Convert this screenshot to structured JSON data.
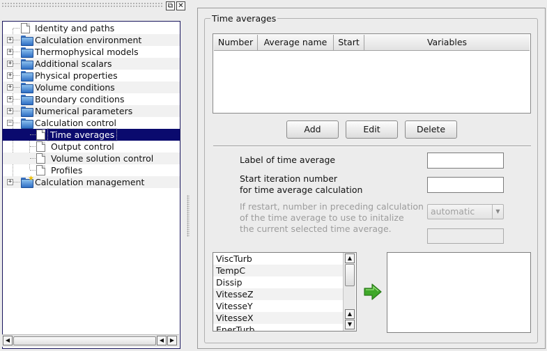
{
  "tree": {
    "items": [
      {
        "label": "Identity and paths",
        "level": 0,
        "icon": "page-icon",
        "expandable": false,
        "selected": false
      },
      {
        "label": "Calculation environment",
        "level": 0,
        "icon": "folder-icon",
        "expandable": true,
        "selected": false
      },
      {
        "label": "Thermophysical models",
        "level": 0,
        "icon": "folder-icon",
        "expandable": true,
        "selected": false
      },
      {
        "label": "Additional scalars",
        "level": 0,
        "icon": "folder-icon",
        "expandable": true,
        "selected": false
      },
      {
        "label": "Physical properties",
        "level": 0,
        "icon": "folder-icon",
        "expandable": true,
        "selected": false
      },
      {
        "label": "Volume conditions",
        "level": 0,
        "icon": "folder-icon",
        "expandable": true,
        "selected": false
      },
      {
        "label": "Boundary conditions",
        "level": 0,
        "icon": "folder-icon",
        "expandable": true,
        "selected": false
      },
      {
        "label": "Numerical parameters",
        "level": 0,
        "icon": "folder-icon",
        "expandable": true,
        "selected": false
      },
      {
        "label": "Calculation control",
        "level": 0,
        "icon": "folder-open-icon",
        "expandable": true,
        "expanded": true,
        "selected": false
      },
      {
        "label": "Time averages",
        "level": 1,
        "icon": "page-icon",
        "expandable": false,
        "selected": true
      },
      {
        "label": "Output control",
        "level": 1,
        "icon": "page-icon",
        "expandable": false,
        "selected": false
      },
      {
        "label": "Volume solution control",
        "level": 1,
        "icon": "page-icon",
        "expandable": false,
        "selected": false
      },
      {
        "label": "Profiles",
        "level": 1,
        "icon": "page-icon",
        "expandable": false,
        "selected": false
      },
      {
        "label": "Calculation management",
        "level": 0,
        "icon": "folder-star-icon",
        "expandable": true,
        "selected": false
      }
    ]
  },
  "group_title": "Time averages",
  "table": {
    "headers": [
      "Number",
      "Average name",
      "Start",
      "Variables"
    ],
    "rows": []
  },
  "buttons": {
    "add": "Add",
    "edit": "Edit",
    "delete": "Delete"
  },
  "form": {
    "label_of_average": "Label of time average",
    "start_iteration_line1": "Start iteration number",
    "start_iteration_line2": "for time average calculation",
    "restart_line1": "If restart, number in preceding calculation",
    "restart_line2": "of the time average to use to initalize",
    "restart_line3": "the current selected time average.",
    "restart_combo_value": "automatic",
    "label_value": "",
    "start_value": "",
    "restart_number_value": ""
  },
  "variables": [
    "ViscTurb",
    "TempC",
    "Dissip",
    "VitesseZ",
    "VitesseY",
    "VitesseX",
    "EnerTurb"
  ],
  "selected_variables": [],
  "colors": {
    "selection": "#0a0a6e",
    "tree_border": "#17145c",
    "arrow": "#3fa829"
  }
}
